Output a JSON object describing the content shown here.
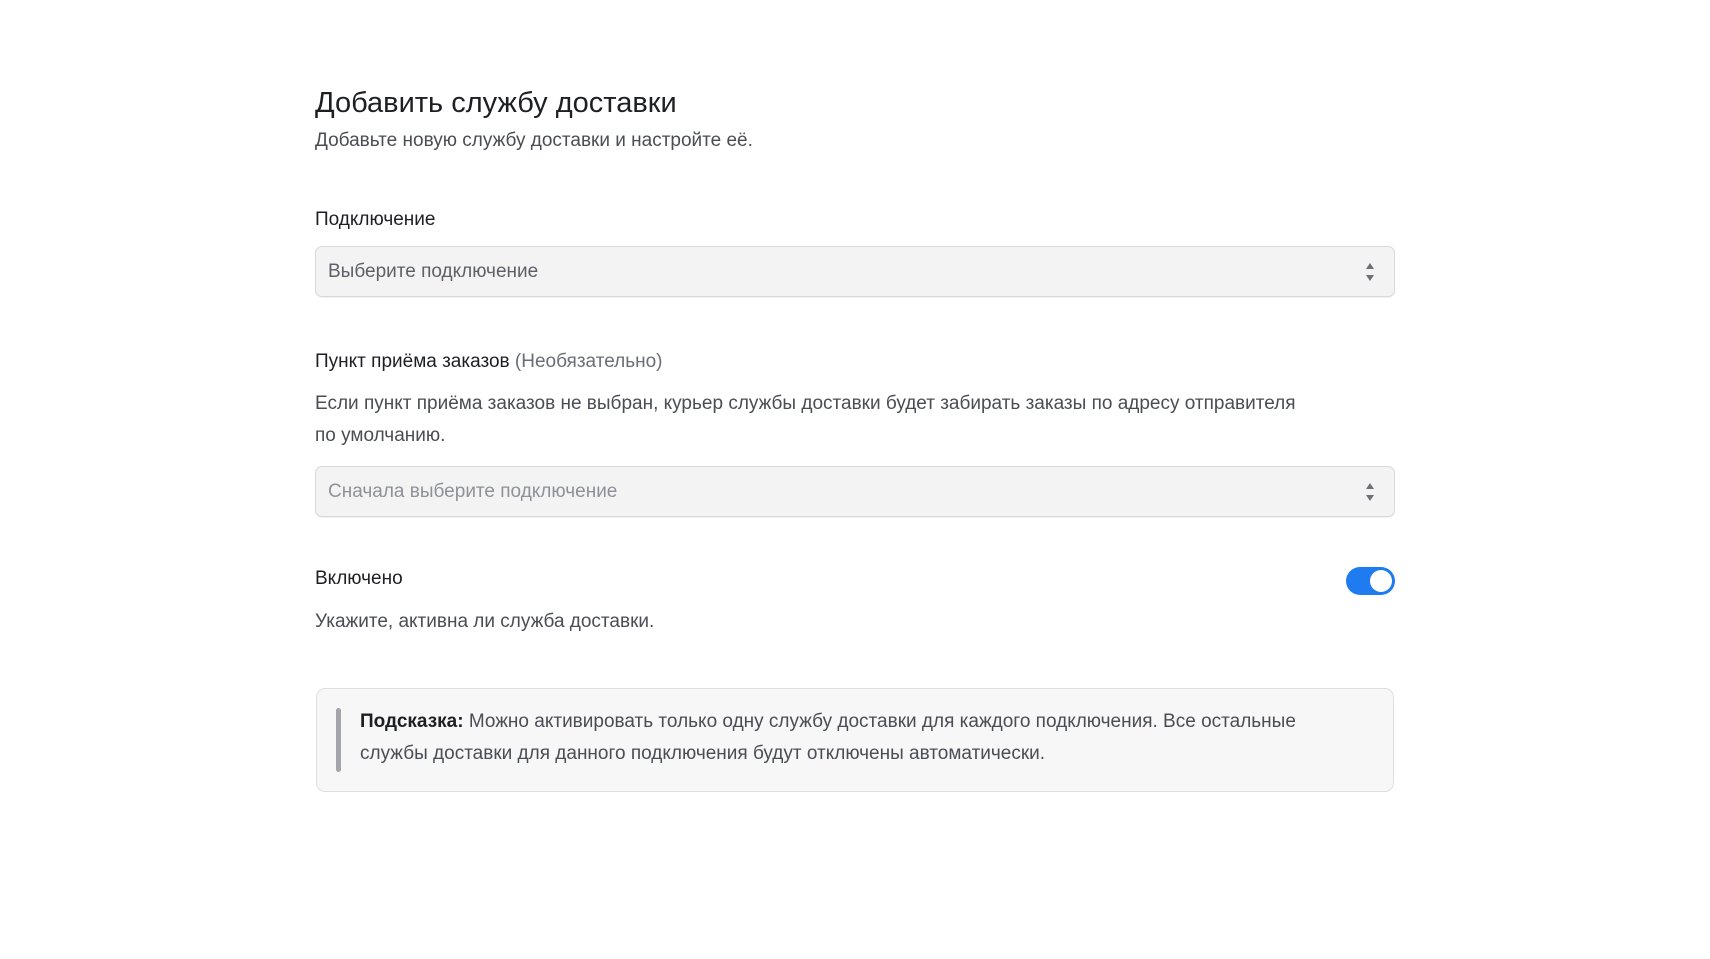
{
  "header": {
    "title": "Добавить службу доставки",
    "subtitle": "Добавьте новую службу доставки и настройте её."
  },
  "connection": {
    "label": "Подключение",
    "placeholder": "Выберите подключение",
    "arrows_icon": "updown-chevron-icon"
  },
  "pickup_point": {
    "label": "Пункт приёма заказов",
    "optional_label": "(Необязательно)",
    "help": "Если пункт приёма заказов не выбран, курьер службы доставки будет забирать заказы по адресу отправителя по умолчанию.",
    "placeholder": "Сначала выберите подключение",
    "disabled": true,
    "arrows_icon": "updown-chevron-icon"
  },
  "enabled": {
    "label": "Включено",
    "description": "Укажите, активна ли служба доставки.",
    "value": true,
    "toggle_color": "#1f7bf0"
  },
  "hint": {
    "label": "Подсказка:",
    "text": "Можно активировать только одну службу доставки для каждого подключения. Все остальные службы доставки для данного подключения будут отключены автоматически."
  }
}
